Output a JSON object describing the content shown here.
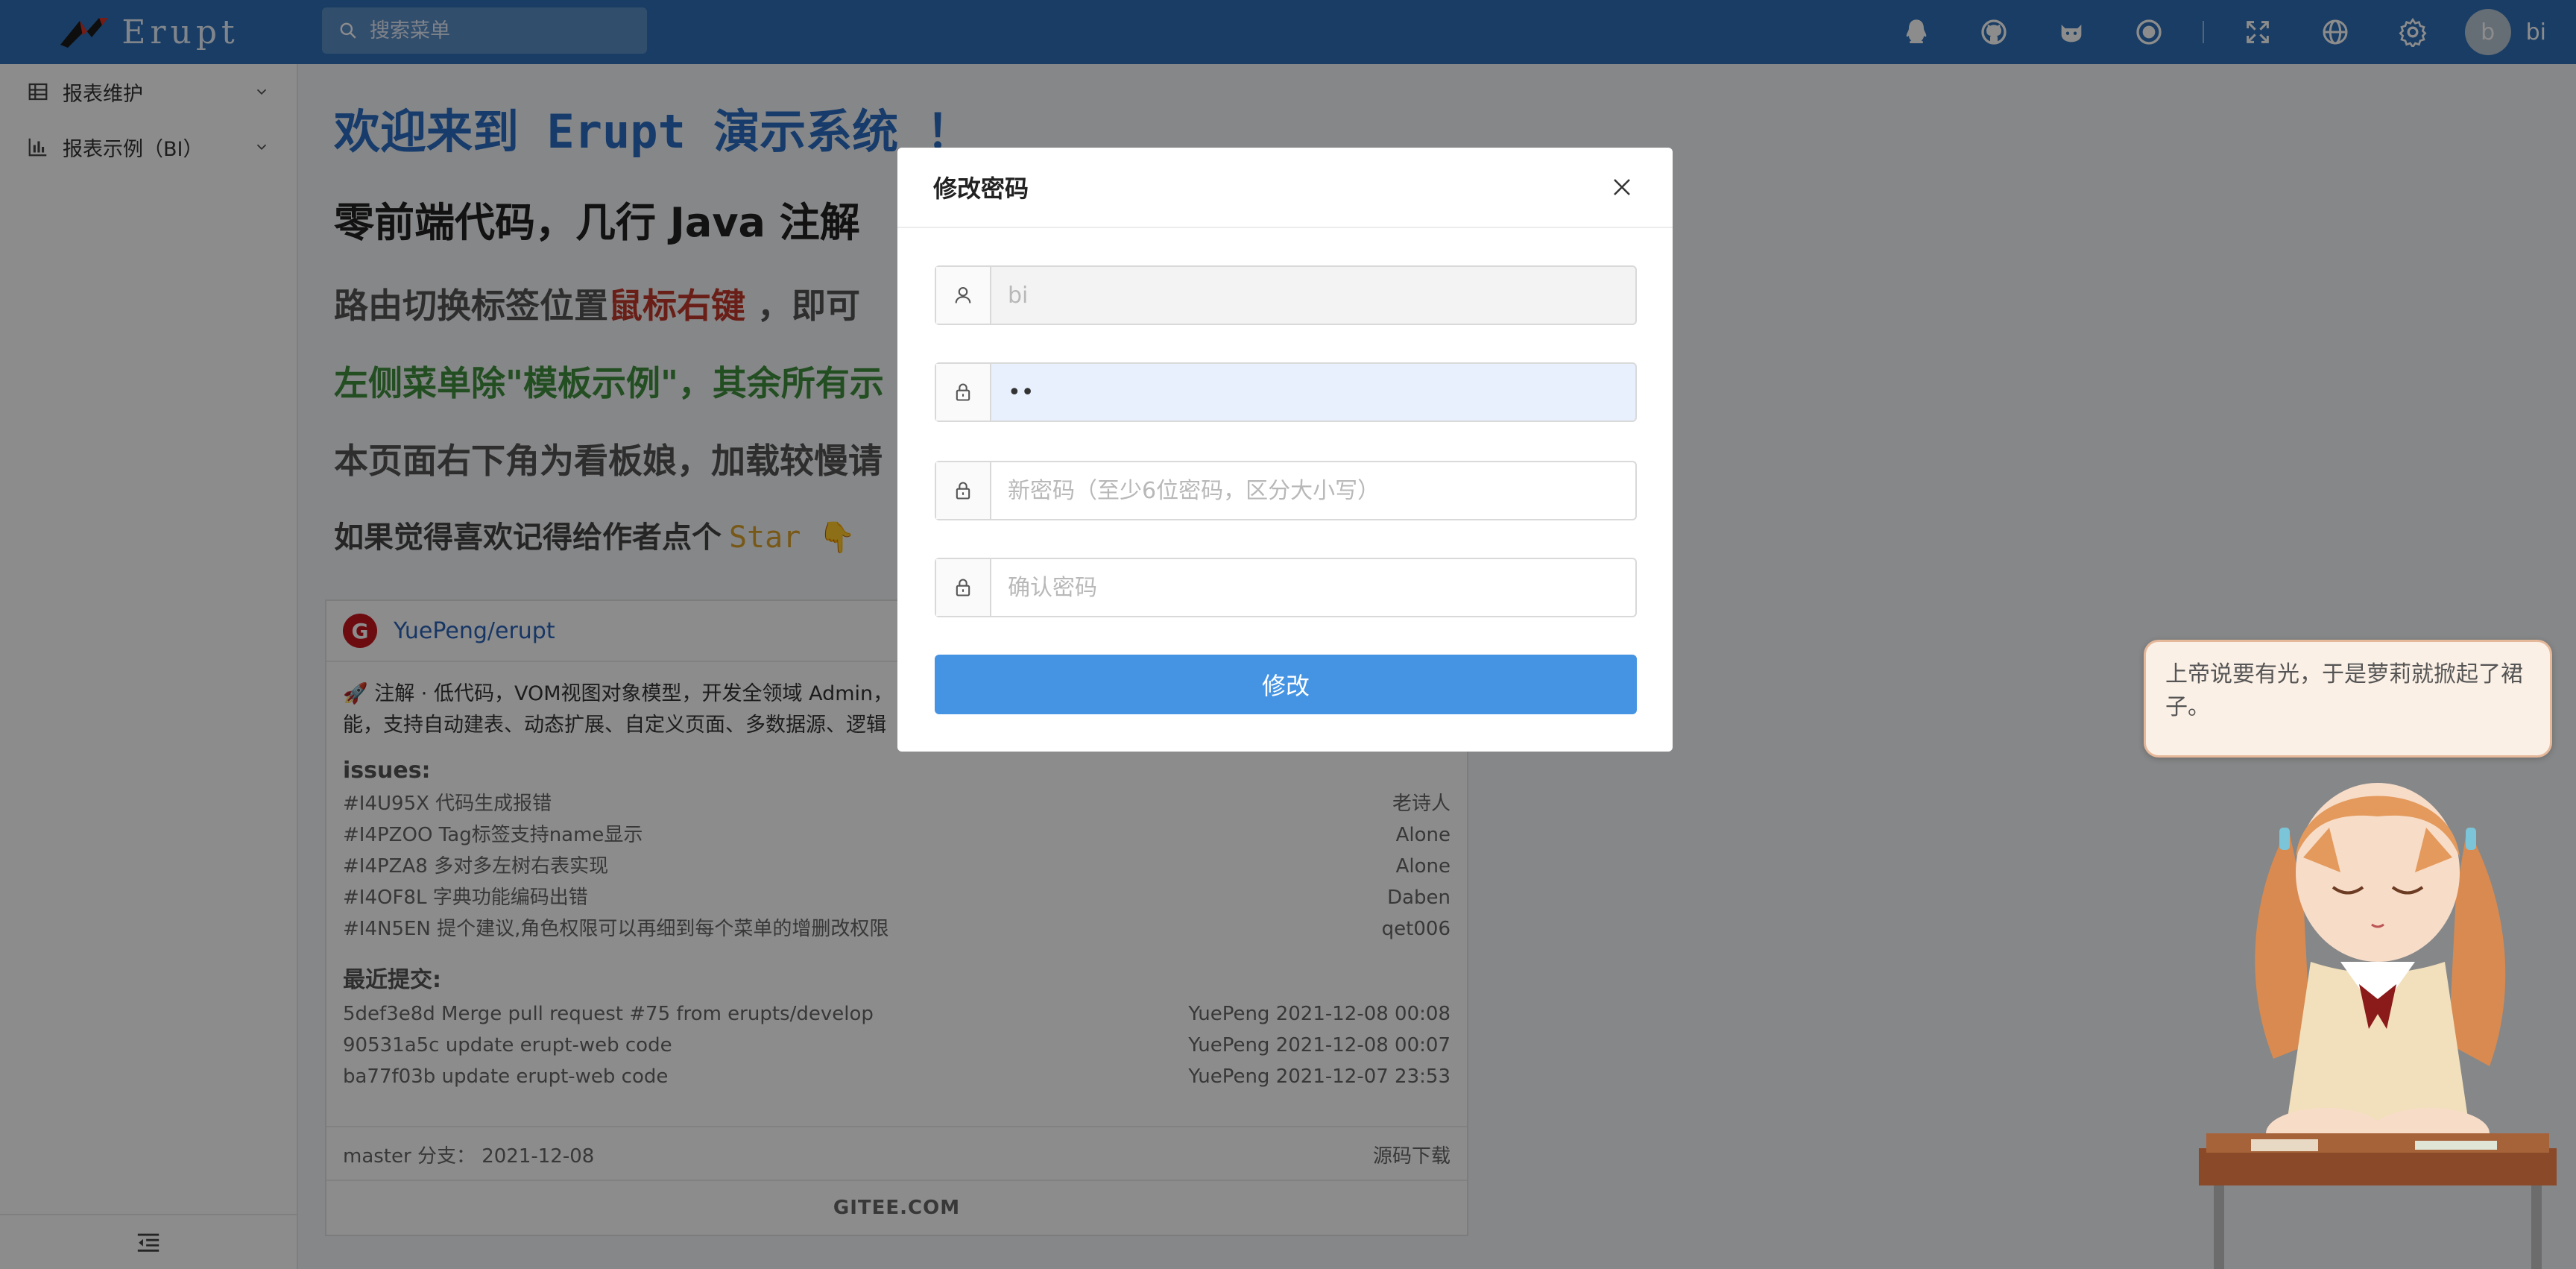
{
  "header": {
    "logo_text": "Erupt",
    "search_placeholder": "搜索菜单",
    "icons": [
      "qq-icon",
      "github-icon",
      "gitee-cat-icon",
      "record-icon",
      "fullscreen-icon",
      "language-icon",
      "settings-icon"
    ],
    "user": {
      "avatar_letter": "b",
      "name": "bi"
    }
  },
  "sidebar": {
    "items": [
      {
        "label": "报表维护",
        "icon": "table-icon"
      },
      {
        "label": "报表示例（BI）",
        "icon": "bar-chart-icon"
      }
    ]
  },
  "main": {
    "welcome": "欢迎来到 Erupt 演示系统 ！",
    "line2": "零前端代码，几行 Java 注解",
    "line3_prefix": "路由切换标签位置",
    "line3_red": "鼠标右键",
    "line3_suffix": " ，即可",
    "line4": "左侧菜单除\"模板示例\"，其余所有示",
    "line5": "本页面右下角为看板娘，加载较慢请",
    "line6": "如果觉得喜欢记得给作者点个",
    "line6_star": "Star 👇"
  },
  "card": {
    "logo_letter": "G",
    "repo": "YuePeng/erupt",
    "desc_line1": "🚀 注解 · 低代码，VOM视图对象模型，开发全领域 Admin，",
    "desc_line2": "能，支持自动建表、动态扩展、自定义页面、多数据源、逻辑",
    "issues_title": "issues:",
    "issues": [
      {
        "title": "#I4U95X 代码生成报错",
        "author": "老诗人"
      },
      {
        "title": "#I4PZOO Tag标签支持name显示",
        "author": "Alone"
      },
      {
        "title": "#I4PZA8 多对多左树右表实现",
        "author": "Alone"
      },
      {
        "title": "#I4OF8L 字典功能编码出错",
        "author": "Daben"
      },
      {
        "title": "#I4N5EN 提个建议,角色权限可以再细到每个菜单的增删改权限",
        "author": "qet006"
      }
    ],
    "commits_title": "最近提交:",
    "commits": [
      {
        "msg": "5def3e8d   Merge pull request #75 from erupts/develop",
        "meta": "YuePeng 2021-12-08 00:08"
      },
      {
        "msg": "90531a5c   update erupt-web code",
        "meta": "YuePeng 2021-12-08 00:07"
      },
      {
        "msg": "ba77f03b   update erupt-web code",
        "meta": "YuePeng 2021-12-07 23:53"
      }
    ],
    "branch": "master 分支：  2021-12-08",
    "download": "源码下载",
    "brand": "GITEE.COM"
  },
  "mascot": {
    "bubble": "上帝说要有光，于是萝莉就掀起了裙子。"
  },
  "modal": {
    "title": "修改密码",
    "username_value": "bi",
    "old_password_value": "••",
    "new_password_placeholder": "新密码（至少6位密码，区分大小写）",
    "confirm_password_placeholder": "确认密码",
    "submit_label": "修改"
  },
  "colors": {
    "header": "#2e6fb6",
    "primary_button": "#4594e3",
    "welcome_blue": "#2b6dc4",
    "highlight_red": "#c0392b",
    "green": "#3f8f3f",
    "star_gold": "#d9a12a"
  }
}
